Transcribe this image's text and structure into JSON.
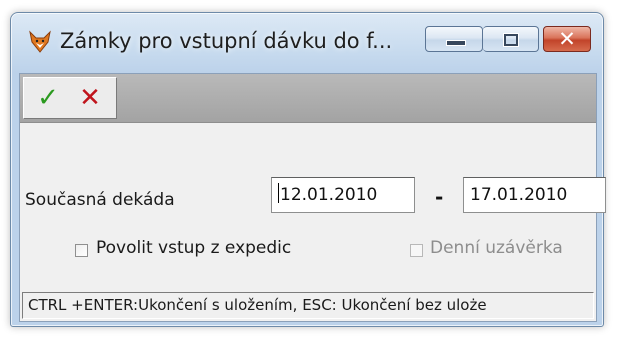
{
  "window": {
    "title": "Zámky pro vstupní dávku do f...",
    "app_icon": "fox-icon",
    "buttons": {
      "minimize": "minimize-icon",
      "maximize": "maximize-icon",
      "close": "close-icon"
    }
  },
  "toolbar": {
    "ok_icon": "checkmark-icon",
    "cancel_icon": "cross-icon",
    "ok_glyph": "✓",
    "cancel_glyph": "✕"
  },
  "form": {
    "decade_label": "Současná dekáda",
    "date_from": "12.01.2010",
    "separator": "-",
    "date_to": "17.01.2010",
    "allow_expedic_label": "Povolit vstup z expedic",
    "allow_expedic_checked": false,
    "daily_close_label": "Denní uzávěrka",
    "daily_close_checked": false,
    "daily_close_enabled": false
  },
  "status": {
    "text": "CTRL +ENTER:Ukončení s uložením, ESC: Ukončení bez uloże"
  },
  "colors": {
    "ok": "#2b9a1f",
    "cancel": "#c0141c",
    "toolbar_bg": "#a8a8a8",
    "client_bg": "#f0f0f0",
    "close_button": "#c2442a"
  }
}
